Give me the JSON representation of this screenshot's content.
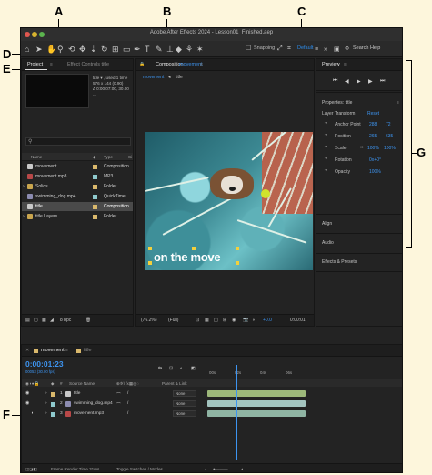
{
  "callouts": {
    "a": "A",
    "b": "B",
    "c": "C",
    "d": "D",
    "e": "E",
    "f": "F",
    "g": "G"
  },
  "window": {
    "title": "Adobe After Effects 2024 - Lesson01_Finished.aep"
  },
  "toolbar": {
    "snapping_label": "Snapping",
    "workspace": "Default",
    "search_help": "Search Help"
  },
  "project_panel": {
    "tab_project": "Project",
    "tab_effect_controls": "Effect Controls title",
    "selected_info": [
      "title ▾ , used 1 time",
      "576 x 144 (0.90)",
      "Δ 0:00:07:00, 30.00 ..."
    ],
    "search_placeholder": "",
    "col_name": "Name",
    "col_type": "Type",
    "col_size": "Si",
    "items": [
      {
        "name": "movement",
        "type": "Composition",
        "color": "#d9b86c",
        "icon": "composition-icon"
      },
      {
        "name": "movement.mp3",
        "type": "MP3",
        "color": "#8ec9cc",
        "icon": "audio-file-icon"
      },
      {
        "name": "Solids",
        "type": "Folder",
        "color": "#d9b86c",
        "icon": "folder-icon"
      },
      {
        "name": "swimming_dog.mp4",
        "type": "QuickTime",
        "color": "#8ec9cc",
        "icon": "video-file-icon"
      },
      {
        "name": "title",
        "type": "Composition",
        "color": "#d9b86c",
        "icon": "composition-icon"
      },
      {
        "name": "title Layers",
        "type": "Folder",
        "color": "#d9b86c",
        "icon": "folder-icon"
      }
    ],
    "bpc": "8 bpc"
  },
  "composition_panel": {
    "tab_label": "Composition",
    "tab_comp": "movement",
    "breadcrumb": [
      "movement",
      "title"
    ],
    "overlay_text": "on the move",
    "zoom": "(76.2%)",
    "resolution": "(Full)",
    "exposure": "+0.0",
    "timecode": "0:00:01"
  },
  "preview_panel": {
    "title": "Preview"
  },
  "properties_panel": {
    "title": "Properties: title",
    "layer_transform": "Layer Transform",
    "reset": "Reset",
    "props": [
      {
        "label": "Anchor Point",
        "v1": "288",
        "v2": "72"
      },
      {
        "label": "Position",
        "v1": "265",
        "v2": "635"
      },
      {
        "label": "Scale",
        "v1": "100%",
        "v2": "100%"
      },
      {
        "label": "Rotation",
        "v1": "0x+0°",
        "v2": ""
      },
      {
        "label": "Opacity",
        "v1": "100%",
        "v2": ""
      }
    ],
    "sections": [
      "Align",
      "Audio",
      "Effects & Presets"
    ]
  },
  "timeline": {
    "tab_movement": "movement",
    "tab_title": "title",
    "timecode": "0:00:01:23",
    "fps": "00053 (30.00 fps)",
    "col_source": "Source Name",
    "col_parent": "Parent & Link",
    "layers": [
      {
        "num": "1",
        "name": "title",
        "parent": "None",
        "color": "#d9b86c",
        "bar": "#9db87a"
      },
      {
        "num": "2",
        "name": "swimming_dog.mp4",
        "parent": "None",
        "color": "#8ec9cc",
        "bar": "#a3c4bf"
      },
      {
        "num": "3",
        "name": "movement.mp3",
        "parent": "None",
        "color": "#8ec9cc",
        "bar": "#8fb4a3"
      }
    ],
    "ruler": [
      "00s",
      "02s",
      "04s",
      "06s"
    ],
    "frame_render_time": "Frame Render Time 31ms",
    "toggle_switches": "Toggle Switches / Modes"
  }
}
